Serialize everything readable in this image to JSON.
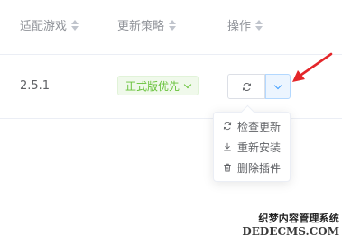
{
  "table": {
    "columns": [
      {
        "label": "适配游戏"
      },
      {
        "label": "更新策略"
      },
      {
        "label": "操作"
      }
    ],
    "rows": [
      {
        "version": "2.5.1",
        "strategy": "正式版优先"
      }
    ]
  },
  "dropdown": {
    "items": [
      {
        "label": "检查更新",
        "icon": "refresh-icon"
      },
      {
        "label": "重新安装",
        "icon": "download-icon"
      },
      {
        "label": "删除插件",
        "icon": "trash-icon"
      }
    ]
  },
  "watermark": {
    "line1": "织梦内容管理系统",
    "line2": "DEDECMS.COM"
  },
  "colors": {
    "tag_green": "#67c23a",
    "accent_blue": "#409eff",
    "arrow_red": "#e4262a"
  }
}
